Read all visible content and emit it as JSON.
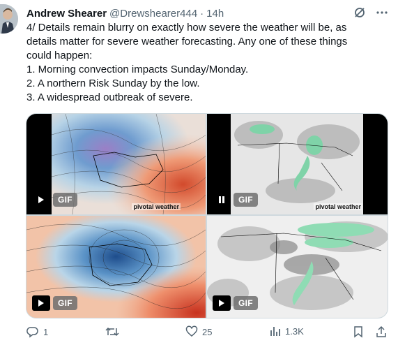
{
  "tweet": {
    "author_name": "Andrew Shearer",
    "handle": "@Drewshearer444",
    "separator": "·",
    "time": "14h",
    "text_lines": [
      "4/ Details remain blurry on exactly how severe the weather will be, as",
      "details matter for severe weather forecasting. Any one of these things",
      "could happen:",
      "1. Morning convection impacts Sunday/Monday.",
      "2. A northern Risk Sunday by the low.",
      "3. A widespread outbreak of severe."
    ]
  },
  "media": {
    "items": [
      {
        "badge": "GIF",
        "control": "play",
        "watermark": "pivotal weather"
      },
      {
        "badge": "GIF",
        "control": "pause",
        "watermark": "pivotal weather"
      },
      {
        "badge": "GIF",
        "control": "play"
      },
      {
        "badge": "GIF",
        "control": "play"
      }
    ]
  },
  "actions": {
    "replies": "1",
    "retweets": "",
    "likes": "25",
    "views": "1.3K"
  },
  "icons": [
    "grok-icon",
    "more-icon",
    "reply-icon",
    "retweet-icon",
    "like-icon",
    "views-icon",
    "bookmark-icon",
    "share-icon"
  ],
  "colors": {
    "secondary_text": "#536471",
    "border": "#cfd9de",
    "text": "#0f1419"
  }
}
